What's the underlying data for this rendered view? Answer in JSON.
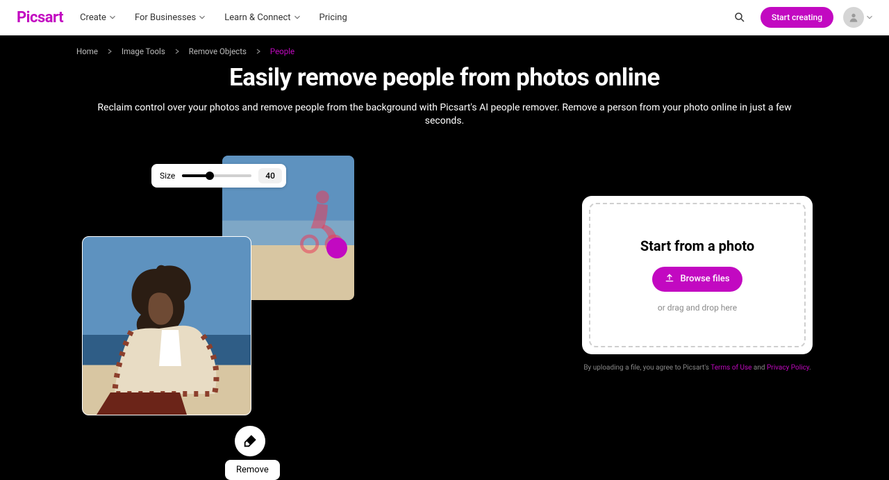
{
  "brand": "Picsart",
  "nav": {
    "items": [
      {
        "label": "Create",
        "has_dropdown": true
      },
      {
        "label": "For Businesses",
        "has_dropdown": true
      },
      {
        "label": "Learn & Connect",
        "has_dropdown": true
      },
      {
        "label": "Pricing",
        "has_dropdown": false
      }
    ],
    "cta": "Start creating"
  },
  "breadcrumbs": [
    {
      "label": "Home",
      "active": false
    },
    {
      "label": "Image Tools",
      "active": false
    },
    {
      "label": "Remove Objects",
      "active": false
    },
    {
      "label": "People",
      "active": true
    }
  ],
  "hero": {
    "title": "Easily remove people from photos online",
    "subtitle": "Reclaim control over your photos and remove people from the background with Picsart's AI people remover. Remove a person from your photo online in just a few seconds."
  },
  "tool": {
    "size_label": "Size",
    "size_value": "40",
    "remove_label": "Remove"
  },
  "upload": {
    "title": "Start from a photo",
    "browse_label": "Browse files",
    "drag_hint": "or drag and drop here",
    "legal_prefix": "By uploading a file, you agree to Picsart's ",
    "terms_label": "Terms of Use",
    "and_label": " and ",
    "privacy_label": "Privacy Policy",
    "period": "."
  },
  "colors": {
    "accent": "#c209c1"
  }
}
